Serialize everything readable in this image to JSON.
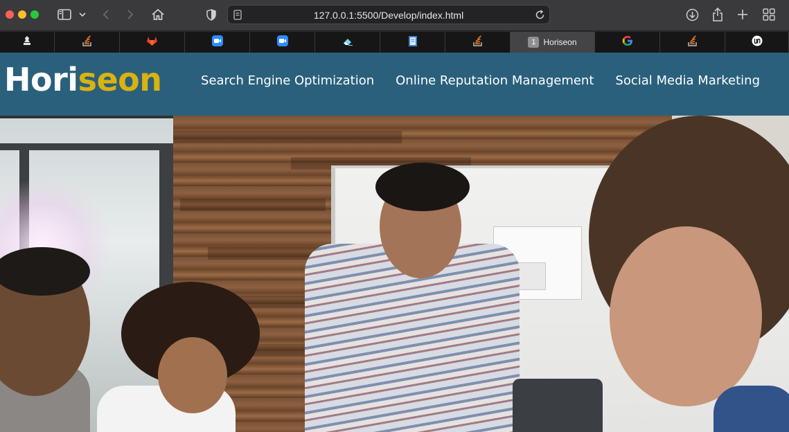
{
  "browser": {
    "url": "127.0.0.1:5500/Develop/index.html",
    "tabs": [
      {
        "icon": "bcu-icon",
        "label": ""
      },
      {
        "icon": "stack-overflow-icon",
        "label": ""
      },
      {
        "icon": "gitlab-icon",
        "label": ""
      },
      {
        "icon": "zoom-icon",
        "label": ""
      },
      {
        "icon": "zoom-icon",
        "label": ""
      },
      {
        "icon": "eraser-icon",
        "label": ""
      },
      {
        "icon": "document-icon",
        "label": ""
      },
      {
        "icon": "stack-overflow-icon",
        "label": ""
      },
      {
        "icon": "tab-number-badge",
        "badge": "1",
        "label": "Horiseon",
        "active": true
      },
      {
        "icon": "google-icon",
        "label": ""
      },
      {
        "icon": "stack-overflow-icon",
        "label": ""
      },
      {
        "icon": "unsplash-icon",
        "label": ""
      }
    ]
  },
  "site": {
    "logo_main": "Hori",
    "logo_accent": "seon",
    "nav": [
      "Search Engine Optimization",
      "Online Reputation Management",
      "Social Media Marketing"
    ]
  },
  "colors": {
    "header_bg": "#2a607c",
    "logo_accent": "#d9b310"
  }
}
